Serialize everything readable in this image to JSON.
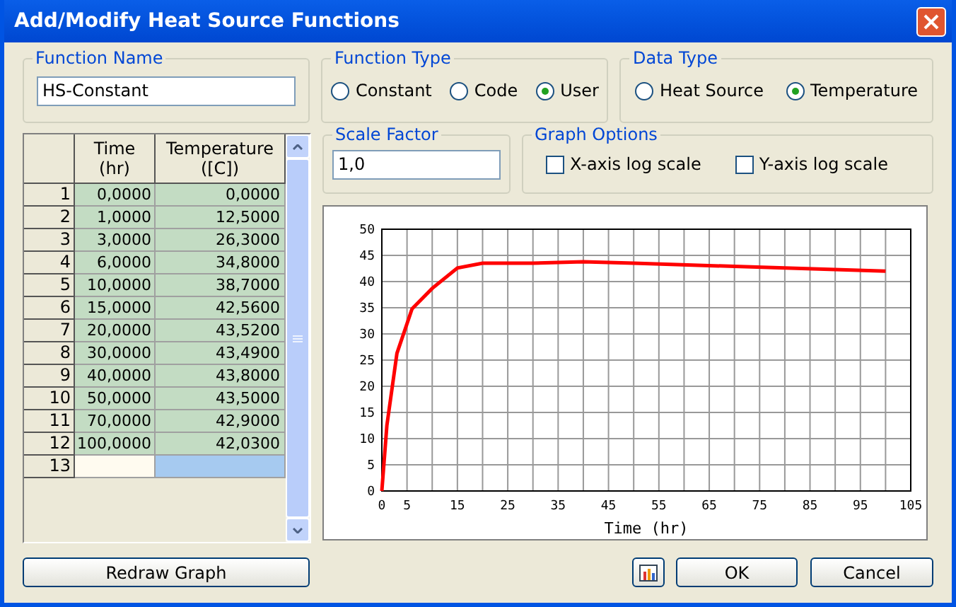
{
  "window": {
    "title": "Add/Modify Heat Source Functions"
  },
  "function_name": {
    "label": "Function Name",
    "value": "HS-Constant"
  },
  "function_type": {
    "label": "Function Type",
    "options": [
      {
        "label": "Constant",
        "selected": false
      },
      {
        "label": "Code",
        "selected": false
      },
      {
        "label": "User",
        "selected": true
      }
    ]
  },
  "data_type": {
    "label": "Data Type",
    "options": [
      {
        "label": "Heat Source",
        "selected": false
      },
      {
        "label": "Temperature",
        "selected": true
      }
    ]
  },
  "scale_factor": {
    "label": "Scale Factor",
    "value": "1,0"
  },
  "graph_options": {
    "label": "Graph Options",
    "options": [
      {
        "label": "X-axis log scale",
        "checked": false
      },
      {
        "label": "Y-axis log scale",
        "checked": false
      }
    ]
  },
  "table": {
    "columns": [
      "Time\n(hr)",
      "Temperature\n([C])"
    ],
    "rows": [
      {
        "number": "1",
        "time": "0,0000",
        "temperature": "0,0000",
        "selected": false
      },
      {
        "number": "2",
        "time": "1,0000",
        "temperature": "12,5000",
        "selected": false
      },
      {
        "number": "3",
        "time": "3,0000",
        "temperature": "26,3000",
        "selected": false
      },
      {
        "number": "4",
        "time": "6,0000",
        "temperature": "34,8000",
        "selected": false
      },
      {
        "number": "5",
        "time": "10,0000",
        "temperature": "38,7000",
        "selected": false
      },
      {
        "number": "6",
        "time": "15,0000",
        "temperature": "42,5600",
        "selected": false
      },
      {
        "number": "7",
        "time": "20,0000",
        "temperature": "43,5200",
        "selected": false
      },
      {
        "number": "8",
        "time": "30,0000",
        "temperature": "43,4900",
        "selected": false
      },
      {
        "number": "9",
        "time": "40,0000",
        "temperature": "43,8000",
        "selected": false
      },
      {
        "number": "10",
        "time": "50,0000",
        "temperature": "43,5000",
        "selected": false
      },
      {
        "number": "11",
        "time": "70,0000",
        "temperature": "42,9000",
        "selected": false
      },
      {
        "number": "12",
        "time": "100,0000",
        "temperature": "42,0300",
        "selected": false
      },
      {
        "number": "13",
        "selected": true
      }
    ]
  },
  "graph": {
    "chart_data": {
      "type": "line",
      "xlabel": "Time (hr)",
      "xlim": [
        0,
        105
      ],
      "ylim": [
        0,
        50
      ],
      "xticks": [
        0,
        5,
        15,
        25,
        35,
        45,
        55,
        65,
        75,
        85,
        95,
        105
      ],
      "yticks": [
        0,
        5,
        10,
        15,
        20,
        25,
        30,
        35,
        40,
        45,
        50
      ],
      "x": [
        0,
        1,
        3,
        6,
        10,
        15,
        20,
        30,
        40,
        50,
        70,
        100
      ],
      "grid": true,
      "series": [
        {
          "color": "#ff0000",
          "values": [
            0,
            12.5,
            26.3,
            34.8,
            38.7,
            42.6,
            43.5,
            43.5,
            43.8,
            43.5,
            42.9,
            42.0
          ]
        }
      ]
    }
  },
  "buttons": {
    "redraw": "Redraw Graph",
    "ok": "OK",
    "cancel": "Cancel"
  }
}
